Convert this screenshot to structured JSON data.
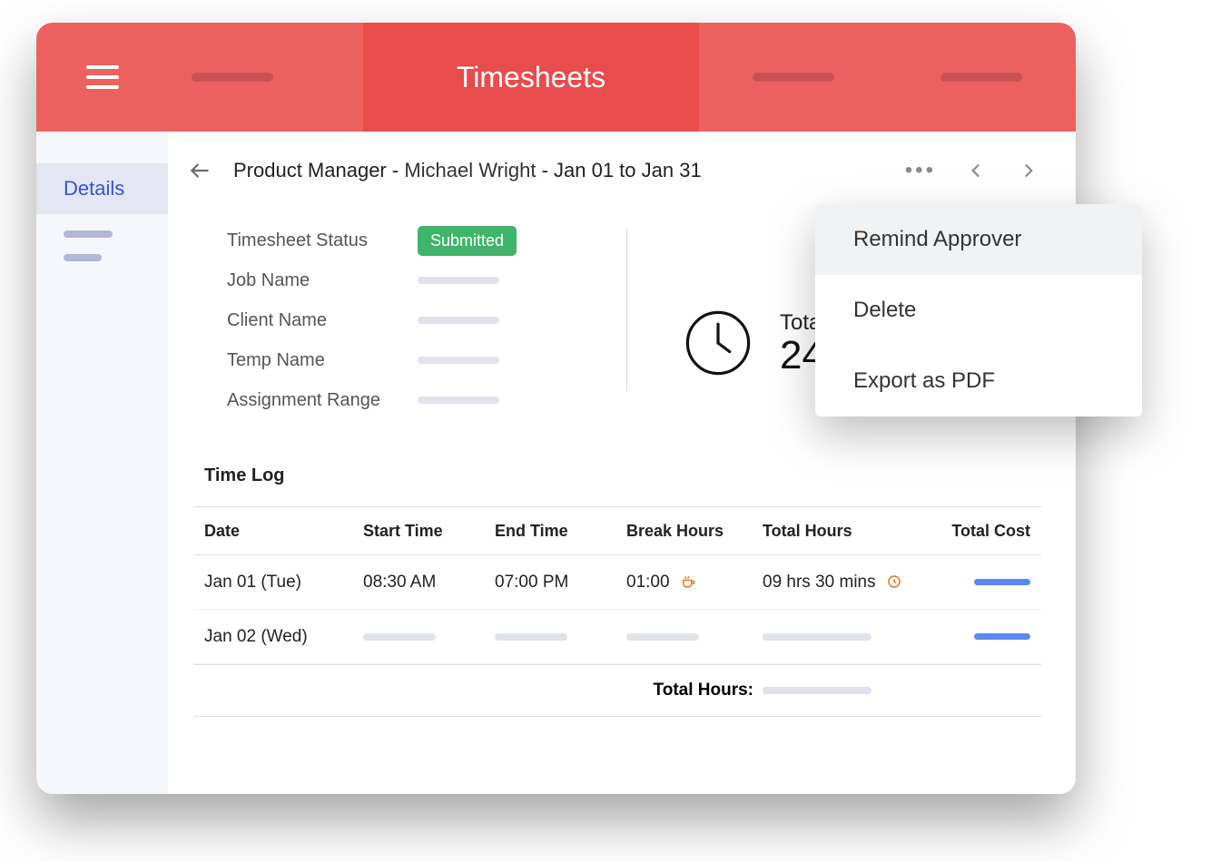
{
  "header": {
    "title": "Timesheets"
  },
  "sidebar": {
    "active_label": "Details"
  },
  "main": {
    "crumb_role": "Product Manager",
    "crumb_person": "Michael Wright",
    "crumb_range": "Jan 01 to Jan 31",
    "info": {
      "label_status": "Timesheet Status",
      "status_value": "Submitted",
      "label_job": "Job Name",
      "label_client": "Client Name",
      "label_temp": "Temp Name",
      "label_range": "Assignment Range"
    },
    "total": {
      "label": "Total",
      "hours": "24"
    },
    "section_title": "Time Log",
    "columns": {
      "date": "Date",
      "start": "Start Time",
      "end": "End Time",
      "break": "Break Hours",
      "total": "Total Hours",
      "cost": "Total Cost"
    },
    "rows": [
      {
        "date": "Jan 01 (Tue)",
        "start": "08:30 AM",
        "end": "07:00 PM",
        "break": "01:00",
        "total": "09 hrs 30 mins"
      },
      {
        "date": "Jan 02 (Wed)",
        "start": "",
        "end": "",
        "break": "",
        "total": ""
      }
    ],
    "footer_label": "Total Hours:"
  },
  "popover": {
    "item_remind": "Remind Approver",
    "item_delete": "Delete",
    "item_export": "Export as PDF"
  }
}
